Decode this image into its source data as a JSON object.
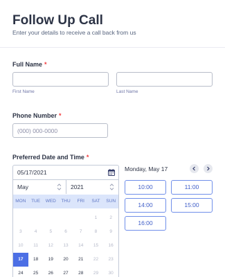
{
  "form": {
    "title": "Follow Up Call",
    "subtitle": "Enter your details to receive a call back from us"
  },
  "full_name": {
    "label": "Full Name",
    "required": "*",
    "first_sublabel": "First Name",
    "last_sublabel": "Last Name"
  },
  "phone": {
    "label": "Phone Number",
    "required": "*",
    "placeholder": "(000) 000-0000"
  },
  "date_time": {
    "label": "Preferred Date and Time",
    "required": "*",
    "date_value": "05/17/2021",
    "month": "May",
    "year": "2021",
    "weekdays": [
      "MON",
      "TUE",
      "WED",
      "THU",
      "FRI",
      "SAT",
      "SUN"
    ],
    "weeks": [
      [
        {
          "d": "",
          "s": ""
        },
        {
          "d": "",
          "s": ""
        },
        {
          "d": "",
          "s": ""
        },
        {
          "d": "",
          "s": ""
        },
        {
          "d": "",
          "s": ""
        },
        {
          "d": "1",
          "s": ""
        },
        {
          "d": "2",
          "s": ""
        }
      ],
      [
        {
          "d": "3",
          "s": ""
        },
        {
          "d": "4",
          "s": ""
        },
        {
          "d": "5",
          "s": ""
        },
        {
          "d": "6",
          "s": ""
        },
        {
          "d": "7",
          "s": ""
        },
        {
          "d": "8",
          "s": ""
        },
        {
          "d": "9",
          "s": ""
        }
      ],
      [
        {
          "d": "10",
          "s": ""
        },
        {
          "d": "11",
          "s": ""
        },
        {
          "d": "12",
          "s": ""
        },
        {
          "d": "13",
          "s": ""
        },
        {
          "d": "14",
          "s": ""
        },
        {
          "d": "15",
          "s": ""
        },
        {
          "d": "16",
          "s": ""
        }
      ],
      [
        {
          "d": "17",
          "s": "sel"
        },
        {
          "d": "18",
          "s": "active"
        },
        {
          "d": "19",
          "s": "active"
        },
        {
          "d": "20",
          "s": "active"
        },
        {
          "d": "21",
          "s": "active"
        },
        {
          "d": "22",
          "s": ""
        },
        {
          "d": "23",
          "s": ""
        }
      ],
      [
        {
          "d": "24",
          "s": "active"
        },
        {
          "d": "25",
          "s": "active"
        },
        {
          "d": "26",
          "s": "active"
        },
        {
          "d": "27",
          "s": "active"
        },
        {
          "d": "28",
          "s": "active"
        },
        {
          "d": "29",
          "s": ""
        },
        {
          "d": "30",
          "s": ""
        }
      ]
    ],
    "day_label": "Monday, May 17",
    "slots": [
      "10:00",
      "11:00",
      "14:00",
      "15:00",
      "16:00"
    ]
  },
  "icons": {
    "calendar": "calendar-icon",
    "prev": "chevron-left-icon",
    "next": "chevron-right-icon",
    "spinner": "up-down-icon"
  },
  "colors": {
    "accent": "#4c6fe5",
    "required": "#f23a3c",
    "slot_border": "#6f8ee9",
    "weekday_bg": "#dbe5fb"
  }
}
